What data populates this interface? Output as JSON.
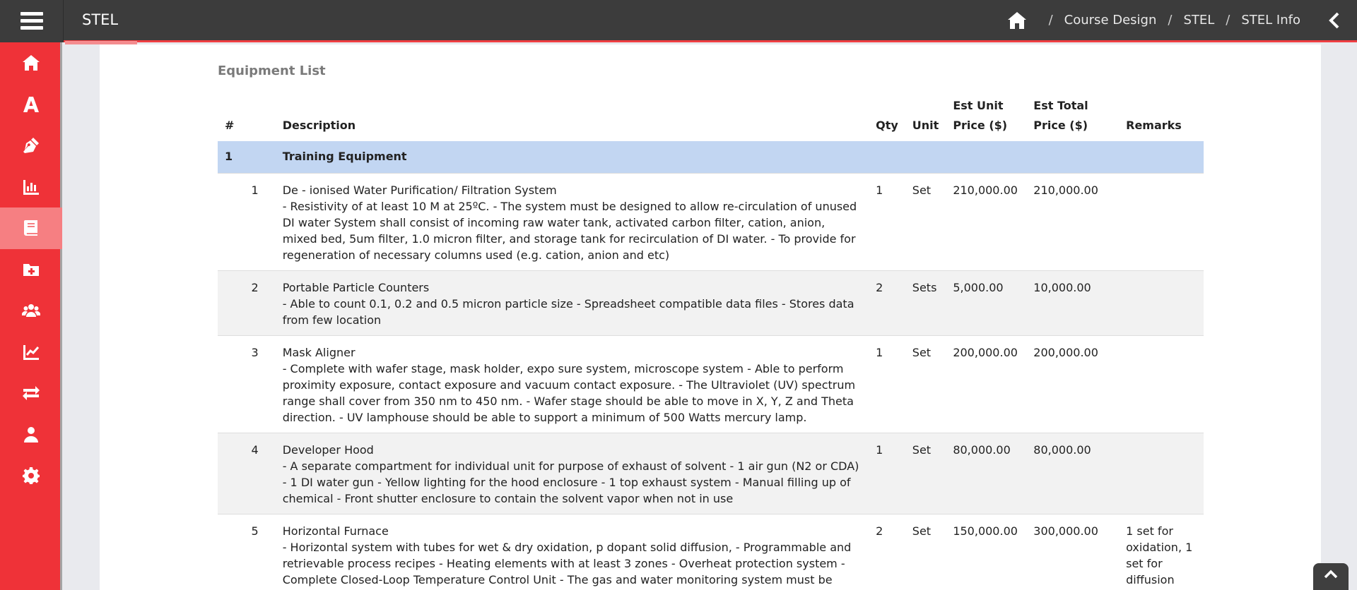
{
  "app": {
    "title": "STEL"
  },
  "breadcrumb": {
    "items": [
      "Course Design",
      "STEL",
      "STEL Info"
    ]
  },
  "sidebar": {
    "items": [
      {
        "icon": "home-icon"
      },
      {
        "icon": "font-a-icon"
      },
      {
        "icon": "pen-nib-icon"
      },
      {
        "icon": "bar-chart-icon"
      },
      {
        "icon": "book-icon",
        "active": true
      },
      {
        "icon": "folder-plus-icon"
      },
      {
        "icon": "users-icon"
      },
      {
        "icon": "line-chart-icon"
      },
      {
        "icon": "exchange-icon"
      },
      {
        "icon": "user-icon"
      },
      {
        "icon": "gear-icon"
      }
    ]
  },
  "equipment": {
    "section_title": "Equipment List",
    "headers": {
      "hash": "#",
      "description": "Description",
      "qty": "Qty",
      "unit": "Unit",
      "est_unit_price": "Est Unit Price ($)",
      "est_total_price": "Est Total Price ($)",
      "remarks": "Remarks"
    },
    "group": {
      "number": "1",
      "name": "Training Equipment"
    },
    "rows": [
      {
        "no": "1",
        "title": "De - ionised Water Purification/ Filtration System",
        "body": "- Resistivity of at least 10 M at 25ºC. - The system must be designed to allow re-circulation of unused DI water System shall consist of incoming raw water tank, activated carbon filter, cation, anion, mixed bed, 5um filter, 1.0 micron filter, and storage tank for recirculation of DI water. - To provide for regeneration of necessary columns used (e.g. cation, anion and etc)",
        "qty": "1",
        "unit": "Set",
        "unit_price": "210,000.00",
        "total_price": "210,000.00",
        "remarks": ""
      },
      {
        "no": "2",
        "title": "Portable Particle Counters",
        "body": "- Able to count 0.1, 0.2 and 0.5 micron particle size - Spreadsheet compatible data files - Stores data from few location",
        "qty": "2",
        "unit": "Sets",
        "unit_price": "5,000.00",
        "total_price": "10,000.00",
        "remarks": ""
      },
      {
        "no": "3",
        "title": "Mask Aligner",
        "body": "- Complete with wafer stage, mask holder, expo sure system, microscope system - Able to perform proximity exposure, contact exposure and vacuum contact exposure. - The Ultraviolet (UV) spectrum range shall cover from 350 nm to 450 nm. - Wafer stage should be able to move in X, Y, Z and Theta direction. - UV lamphouse should be able to support a minimum of 500 Watts mercury lamp.",
        "qty": "1",
        "unit": "Set",
        "unit_price": "200,000.00",
        "total_price": "200,000.00",
        "remarks": ""
      },
      {
        "no": "4",
        "title": "Developer Hood",
        "body": "- A separate compartment for individual unit for purpose of exhaust of solvent - 1 air gun (N2 or CDA) - 1 DI water gun - Yellow lighting for the hood enclosure - 1 top exhaust system - Manual filling up of chemical - Front shutter enclosure to contain the solvent vapor when not in use",
        "qty": "1",
        "unit": "Set",
        "unit_price": "80,000.00",
        "total_price": "80,000.00",
        "remarks": ""
      },
      {
        "no": "5",
        "title": "Horizontal Furnace",
        "body": "- Horizontal system with tubes for wet & dry oxidation, p dopant solid diffusion, - Programmable and retrievable process recipes - Heating elements with at least 3 zones - Overheat protection system - Complete Closed-Loop Temperature Control Unit - The gas and water monitoring system must be",
        "qty": "2",
        "unit": "Set",
        "unit_price": "150,000.00",
        "total_price": "300,000.00",
        "remarks": "1 set for oxidation, 1 set for diffusion"
      }
    ]
  }
}
